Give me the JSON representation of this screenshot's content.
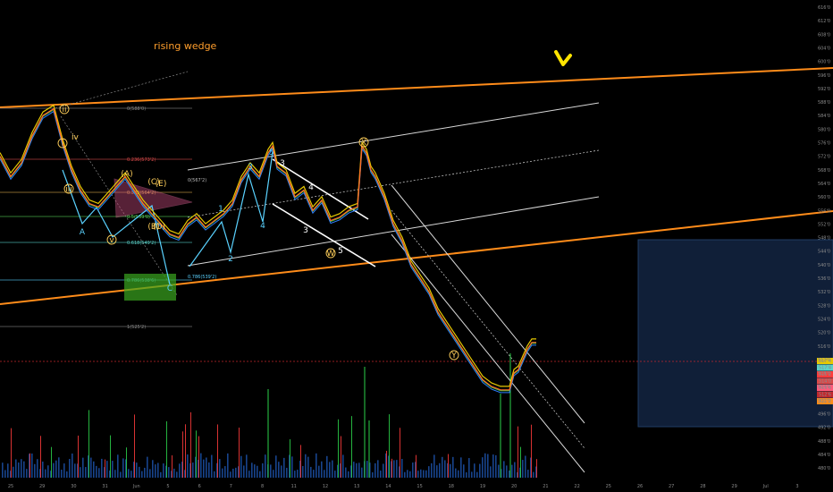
{
  "chart_data": {
    "type": "line",
    "title": "rising wedge",
    "price_axis_ticks": [
      "616'0",
      "612'0",
      "608'0",
      "604'0",
      "600'0",
      "596'0",
      "592'0",
      "588'0",
      "584'0",
      "580'0",
      "576'0",
      "572'0",
      "568'0",
      "564'0",
      "560'0",
      "556'0",
      "552'0",
      "548'0",
      "544'0",
      "540'0",
      "536'0",
      "532'0",
      "528'0",
      "524'0",
      "520'0",
      "516'0",
      "512'0",
      "508'0",
      "504'0",
      "500'0",
      "496'0",
      "492'0",
      "488'0",
      "484'0",
      "480'0"
    ],
    "time_axis_ticks": [
      "25",
      "29",
      "30",
      "31",
      "Jun",
      "5",
      "6",
      "7",
      "8",
      "11",
      "12",
      "13",
      "14",
      "15",
      "18",
      "19",
      "20",
      "21",
      "22",
      "25",
      "26",
      "27",
      "28",
      "29",
      "Jul",
      "3"
    ],
    "price_series": {
      "name": "",
      "x": [
        0,
        12,
        24,
        36,
        48,
        60,
        70,
        80,
        90,
        100,
        110,
        120,
        130,
        140,
        150,
        160,
        170,
        180,
        190,
        200,
        210,
        220,
        230,
        240,
        250,
        260,
        270,
        280,
        290,
        300,
        305,
        310,
        320,
        330,
        340,
        350,
        360,
        370,
        380,
        390,
        400,
        405,
        410,
        415,
        420,
        430,
        440,
        450,
        460,
        470,
        480,
        490,
        500,
        510,
        520,
        530,
        540,
        550,
        560,
        570,
        575,
        580,
        585,
        590,
        595,
        600
      ],
      "y": [
        572,
        566,
        570,
        578,
        584,
        586,
        576,
        568,
        562,
        558,
        557,
        560,
        563,
        566,
        562,
        558,
        555,
        552,
        549,
        548,
        552,
        554,
        551,
        553,
        555,
        558,
        565,
        569,
        566,
        573,
        575,
        569,
        567,
        560,
        562,
        556,
        559,
        553,
        554,
        556,
        557,
        575,
        573,
        568,
        566,
        560,
        552,
        547,
        540,
        536,
        532,
        526,
        522,
        518,
        514,
        510,
        506,
        504,
        503,
        503,
        508,
        509,
        512,
        515,
        517,
        517
      ]
    },
    "fib_levels": [
      {
        "label": "0(588'0)"
      },
      {
        "label": "0.236(573'2)"
      },
      {
        "label": "0.382(564'2)"
      },
      {
        "label": "0.5(559'0)"
      },
      {
        "label": "0.618(549'2)"
      },
      {
        "label": "0.786(538'6)"
      },
      {
        "label": "1(525'2)"
      },
      {
        "label": "0(567'2)"
      },
      {
        "label": "0.786(539'2)"
      }
    ],
    "wave_labels": [
      "ii",
      "i",
      "iv",
      "iii",
      "A",
      "v",
      "(A)",
      "(B)",
      "(C)",
      "(D)",
      "(E)",
      "C",
      "1",
      "2",
      "3",
      "4",
      "5",
      "3",
      "4",
      "5",
      "3",
      "W",
      "X",
      "Y"
    ],
    "price_boxes": [
      "517'4",
      "517'4",
      "515'2",
      "514'0",
      "513'6",
      "512'6",
      "511'2"
    ],
    "colors": {
      "wedge": "#ff8c1a",
      "channel": "#d8d8d8",
      "arrow": "#ffe400",
      "price": "#ff6a2a",
      "ma_yellow": "#e6c800",
      "ma_blue": "#2e7fff",
      "wave_cyan": "#5ad2ff",
      "target_box": "#1e3a66"
    },
    "grid": false
  }
}
